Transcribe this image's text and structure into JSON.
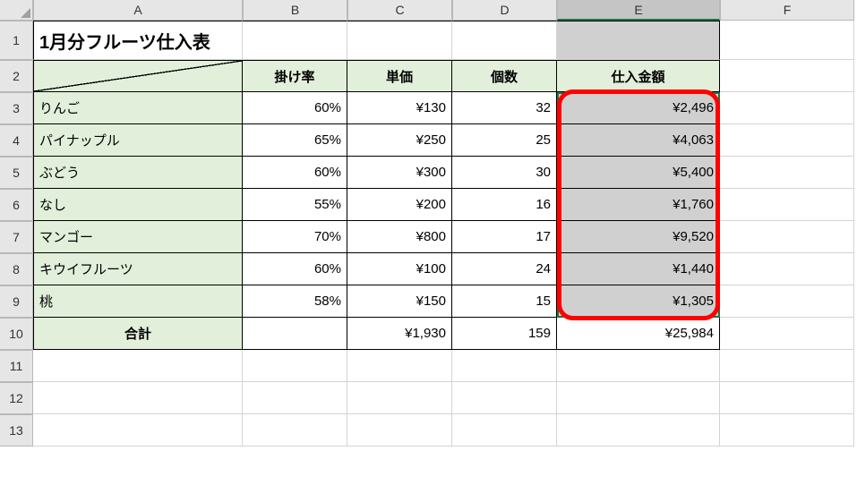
{
  "columns": [
    "A",
    "B",
    "C",
    "D",
    "E",
    "F"
  ],
  "selectedColumn": "E",
  "rows": [
    "1",
    "2",
    "3",
    "4",
    "5",
    "6",
    "7",
    "8",
    "9",
    "10",
    "11",
    "12",
    "13"
  ],
  "title": "1月分フルーツ仕入表",
  "headers": {
    "rate": "掛け率",
    "unitPrice": "単価",
    "qty": "個数",
    "amount": "仕入金額"
  },
  "items": [
    {
      "name": "りんご",
      "rate": "60%",
      "price": "¥130",
      "qty": "32",
      "amount": "¥2,496"
    },
    {
      "name": "パイナップル",
      "rate": "65%",
      "price": "¥250",
      "qty": "25",
      "amount": "¥4,063"
    },
    {
      "name": "ぶどう",
      "rate": "60%",
      "price": "¥300",
      "qty": "30",
      "amount": "¥5,400"
    },
    {
      "name": "なし",
      "rate": "55%",
      "price": "¥200",
      "qty": "16",
      "amount": "¥1,760"
    },
    {
      "name": "マンゴー",
      "rate": "70%",
      "price": "¥800",
      "qty": "17",
      "amount": "¥9,520"
    },
    {
      "name": "キウイフルーツ",
      "rate": "60%",
      "price": "¥100",
      "qty": "24",
      "amount": "¥1,440"
    },
    {
      "name": "桃",
      "rate": "58%",
      "price": "¥150",
      "qty": "15",
      "amount": "¥1,305"
    }
  ],
  "totals": {
    "label": "合計",
    "price": "¥1,930",
    "qty": "159",
    "amount": "¥25,984"
  }
}
